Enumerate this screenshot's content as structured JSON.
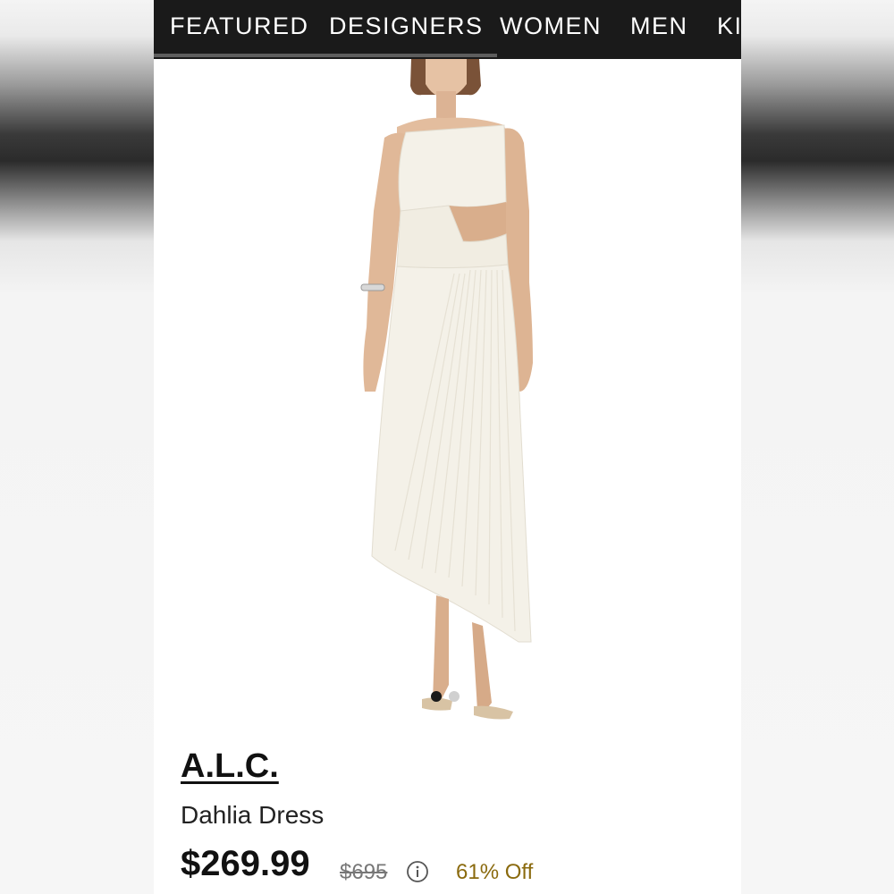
{
  "nav": {
    "items": [
      {
        "label": "FEATURED"
      },
      {
        "label": "DESIGNERS"
      },
      {
        "label": "WOMEN"
      },
      {
        "label": "MEN"
      },
      {
        "label": "KI"
      }
    ]
  },
  "product": {
    "brand": "A.L.C.",
    "name": "Dahlia Dress",
    "sale_price": "$269.99",
    "original_price": "$695",
    "discount": "61% Off",
    "image_alt": "",
    "carousel": {
      "count": 2,
      "active_index": 0
    }
  },
  "colors": {
    "nav_background": "#1a1a1a",
    "nav_text": "#ffffff",
    "discount_text": "#8a6a0e",
    "dress": "#f4f1e8"
  },
  "icons": {
    "info": "info-icon"
  }
}
